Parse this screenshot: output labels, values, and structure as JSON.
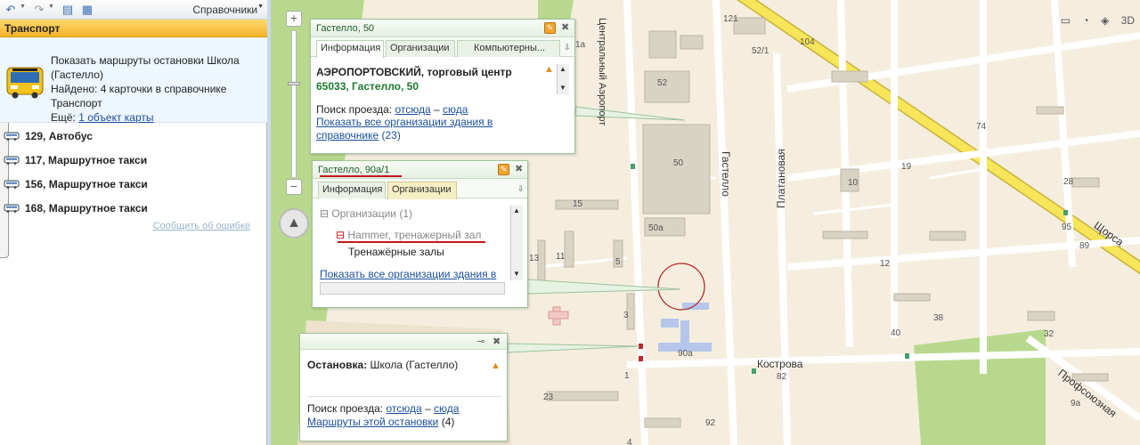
{
  "toolbar": {
    "spravochniki": "Справочники"
  },
  "category": "Транспорт",
  "card": {
    "line1": "Показать маршруты остановки Школа (Гастелло)",
    "line2": "Найдено: 4 карточки в справочнике Транспорт",
    "more_prefix": "Ещё:",
    "more_link": "1 объект карты"
  },
  "routes": [
    {
      "label": "129, Автобус"
    },
    {
      "label": "117, Маршрутное такси"
    },
    {
      "label": "156, Маршрутное такси"
    },
    {
      "label": "168, Маршрутное такси"
    }
  ],
  "report_error": "Сообщить об ошибке",
  "map_tools": {
    "three_d": "3D"
  },
  "popup1": {
    "title": "Гастелло, 50",
    "tabs": [
      "Информация",
      "Организации",
      "Компьютерны..."
    ],
    "org_name": "АЭРОПОРТОВСКИЙ, торговый центр",
    "org_address": "65033, Гастелло, 50",
    "route_prefix": "Поиск проезда:",
    "route_from": "отсюда",
    "route_dash": "–",
    "route_to": "сюда",
    "show_all": "Показать все организации здания в справочнике",
    "show_all_count": "(23)"
  },
  "popup2": {
    "title": "Гастелло, 90а/1",
    "tabs": [
      "Информация",
      "Организации"
    ],
    "group": "Организации (1)",
    "org": "Hammer, тренажерный зал",
    "org_sub": "Тренажёрные залы",
    "show_all": "Показать все организации здания в"
  },
  "popup3": {
    "stop_label": "Остановка:",
    "stop_name": "Школа (Гастелло)",
    "route_prefix": "Поиск проезда:",
    "route_from": "отсюда",
    "route_dash": "–",
    "route_to": "сюда",
    "routes_link": "Маршруты этой остановки",
    "routes_count": "(4)"
  },
  "map_labels": {
    "streets": [
      "Центральный Аэропорт",
      "Гастелло",
      "Платановая",
      "Кострова",
      "Щорса",
      "Профсоюзная"
    ],
    "houses": [
      "121",
      "104",
      "52/1",
      "52",
      "1а",
      "50",
      "50а",
      "15",
      "13",
      "11",
      "5",
      "3",
      "1",
      "23",
      "90а",
      "10",
      "12",
      "19",
      "74",
      "28",
      "95",
      "89",
      "40",
      "38",
      "32",
      "82",
      "92",
      "9а",
      "4"
    ]
  },
  "colors": {
    "yellow_road": "#f7e55a",
    "green": "#b7d98c",
    "panel_header": "#f7c64a",
    "popup_title": "#1f5f2c",
    "link": "#1a4f9c"
  }
}
